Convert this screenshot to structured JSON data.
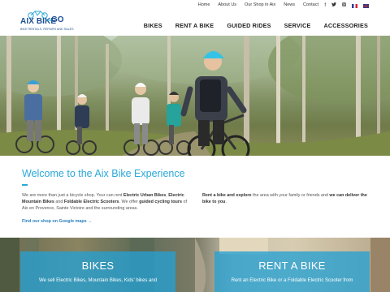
{
  "topbar": {
    "links": [
      "Home",
      "About Us",
      "Our Shop in Aix",
      "News",
      "Contact"
    ],
    "social": [
      "facebook-icon",
      "twitter-icon",
      "instagram-icon"
    ],
    "flags": [
      "fr-flag-icon",
      "gb-flag-icon"
    ]
  },
  "logo": {
    "word": "AIX BIKE",
    "and": "AND",
    "go": "GO",
    "tagline": "BIKE RENTALS, REPAIRS AND SALES"
  },
  "nav": {
    "items": [
      "BIKES",
      "RENT A BIKE",
      "GUIDED RIDES",
      "SERVICE",
      "ACCESSORIES"
    ]
  },
  "welcome": {
    "title": "Welcome to the Aix Bike Experience",
    "left_p1": "We are more than just a bicycle shop. Your can rent ",
    "left_b1": "Electric Urban Bikes",
    "left_p2": ", ",
    "left_b2": "Electric Mountain Bikes",
    "left_p3": " and ",
    "left_b3": "Foldable Electric Scooters",
    "left_p4": ". We offer ",
    "left_b4": "guided cycling tours",
    "left_p5": " of Aix en Provence, Sainte Victoire and the surrounding areas.",
    "right_b1": "Rent a bike and explore",
    "right_p1": " the area with your family or friends and ",
    "right_b2": "we can deliver the bike to you",
    "right_p2": ".",
    "maps_link": "Find our shop on Google maps →"
  },
  "tiles": [
    {
      "title": "BIKES",
      "desc": "We sell Electric Bikes, Mountain Bikes, Kids' bikes and"
    },
    {
      "title": "RENT A BIKE",
      "desc": "Rent an Electric Bike or a Foldable Electric Scooter from"
    }
  ],
  "colors": {
    "accent": "#2aa8d8",
    "brand": "#1d4f91"
  }
}
